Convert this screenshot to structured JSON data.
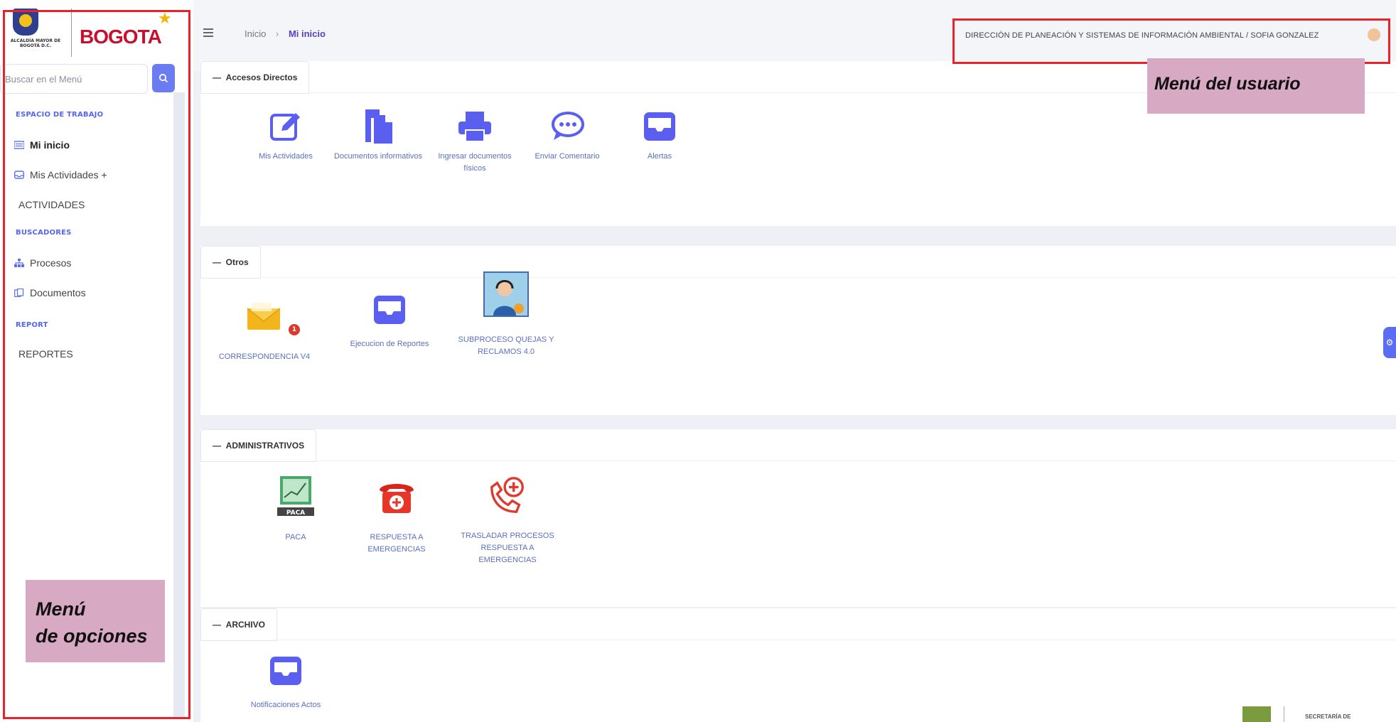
{
  "sidebar": {
    "logo_org": "ALCALDÍA MAYOR DE BOGOTÁ D.C.",
    "logo_word": "BOGOTA",
    "search_placeholder": "Buscar en el Menú",
    "sections": [
      {
        "label": "ESPACIO DE TRABAJO"
      },
      {
        "label": "BUSCADORES"
      },
      {
        "label": "REPORT"
      }
    ],
    "items": [
      {
        "label": "Mi inicio",
        "icon": "list-icon"
      },
      {
        "label": "Mis Actividades +",
        "icon": "inbox-icon"
      },
      {
        "label": "ACTIVIDADES",
        "icon": ""
      },
      {
        "label": "Procesos",
        "icon": "sitemap-icon"
      },
      {
        "label": "Documentos",
        "icon": "documents-icon"
      },
      {
        "label": "REPORTES",
        "icon": ""
      }
    ]
  },
  "topbar": {
    "breadcrumb_home": "Inicio",
    "breadcrumb_current": "Mi inicio",
    "user_text": "DIRECCIÓN DE PLANEACIÓN Y SISTEMAS DE INFORMACIÓN AMBIENTAL / SOFIA GONZALEZ"
  },
  "annotations": {
    "user_menu": "Menú del usuario",
    "options_menu_line1": "Menú",
    "options_menu_line2": "de opciones"
  },
  "sections": [
    {
      "title": "Accesos Directos",
      "tiles": [
        {
          "label": "Mis Actividades",
          "icon": "edit-icon"
        },
        {
          "label": "Documentos informativos",
          "icon": "document-copy-icon"
        },
        {
          "label": "Ingresar documentos físicos",
          "icon": "printer-icon"
        },
        {
          "label": "Enviar Comentario",
          "icon": "comment-icon"
        },
        {
          "label": "Alertas",
          "icon": "inbox-icon"
        }
      ]
    },
    {
      "title": "Otros",
      "tiles": [
        {
          "label": "CORRESPONDENCIA V4",
          "icon": "envelope-icon",
          "badge": "1"
        },
        {
          "label": "Ejecucion de Reportes",
          "icon": "inbox-icon"
        },
        {
          "label": "SUBPROCESO QUEJAS Y RECLAMOS 4.0",
          "icon": "support-agent-icon"
        }
      ]
    },
    {
      "title": "ADMINISTRATIVOS",
      "tiles": [
        {
          "label": "PACA",
          "icon": "paca-chart-icon"
        },
        {
          "label": "RESPUESTA A EMERGENCIAS",
          "icon": "emergency-phone-icon"
        },
        {
          "label": "TRASLADAR PROCESOS RESPUESTA A EMERGENCIAS",
          "icon": "phone-add-icon"
        }
      ]
    },
    {
      "title": "ARCHIVO",
      "tiles": [
        {
          "label": "Notificaciones Actos",
          "icon": "inbox-icon"
        }
      ]
    }
  ],
  "footer": {
    "brand": "SECRETARÍA DE"
  },
  "colors": {
    "accent": "#5b6ef2",
    "icon_blue": "#5a5ff0",
    "annotation_red": "#e8242a",
    "annotation_pink": "#d8a9c2",
    "brand_red": "#c8102e"
  }
}
